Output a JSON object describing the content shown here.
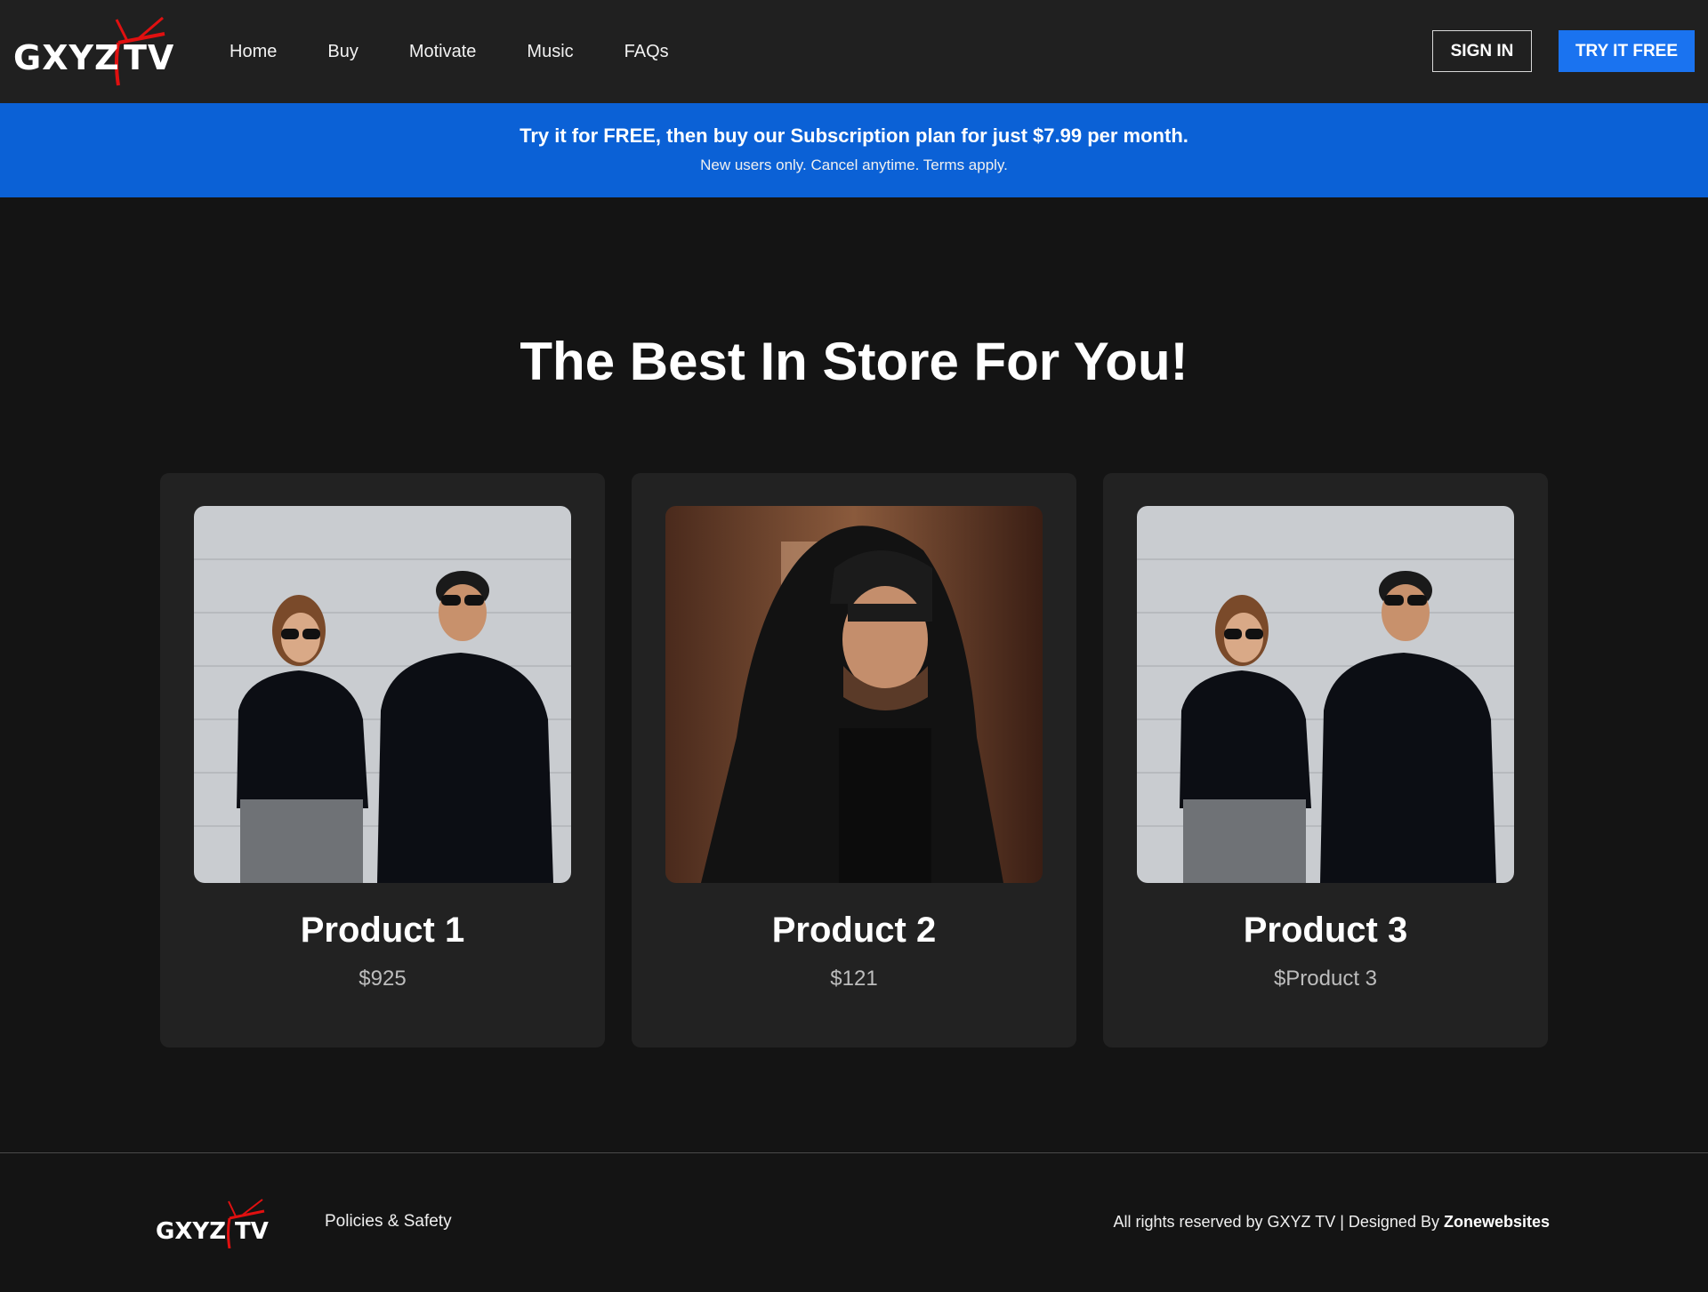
{
  "brand": {
    "logo_left": "GXYZ",
    "logo_right": "TV",
    "accent_color": "#e01010"
  },
  "nav": {
    "items": [
      "Home",
      "Buy",
      "Motivate",
      "Music",
      "FAQs"
    ]
  },
  "header": {
    "signin_label": "SIGN IN",
    "try_label": "TRY IT FREE"
  },
  "promo": {
    "main": "Try it for FREE, then buy our Subscription plan for just $7.99 per month.",
    "sub": "New users only. Cancel anytime. Terms apply."
  },
  "main": {
    "headline": "The Best In Store For You!",
    "products": [
      {
        "title": "Product 1",
        "price": "$925",
        "image": "couple-hoodies-photo"
      },
      {
        "title": "Product 2",
        "price": "$121",
        "image": "man-hooded-jacket-photo"
      },
      {
        "title": "Product 3",
        "price": "$Product 3",
        "image": "couple-hoodies-photo"
      }
    ]
  },
  "footer": {
    "logo_left": "GXYZ",
    "logo_right": "TV",
    "link": "Policies & Safety",
    "copy_prefix": "All rights reserved by GXYZ TV | Designed By ",
    "copy_brand": "Zonewebsites"
  }
}
